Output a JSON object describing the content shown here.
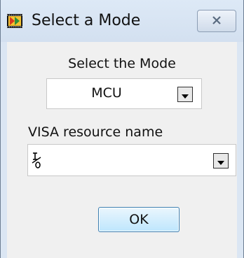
{
  "window": {
    "title": "Select a Mode",
    "icon": "labview-vi-icon",
    "close_icon": "close-icon"
  },
  "mode": {
    "label": "Select the Mode",
    "selected": "MCU"
  },
  "visa": {
    "label": "VISA resource name",
    "value": "",
    "icon": "io-resource-icon"
  },
  "buttons": {
    "ok": "OK"
  },
  "colors": {
    "client_bg": "#f0f0f0",
    "titlebar_bg": "#dbe6f3",
    "ok_border": "#3c7fb1"
  }
}
